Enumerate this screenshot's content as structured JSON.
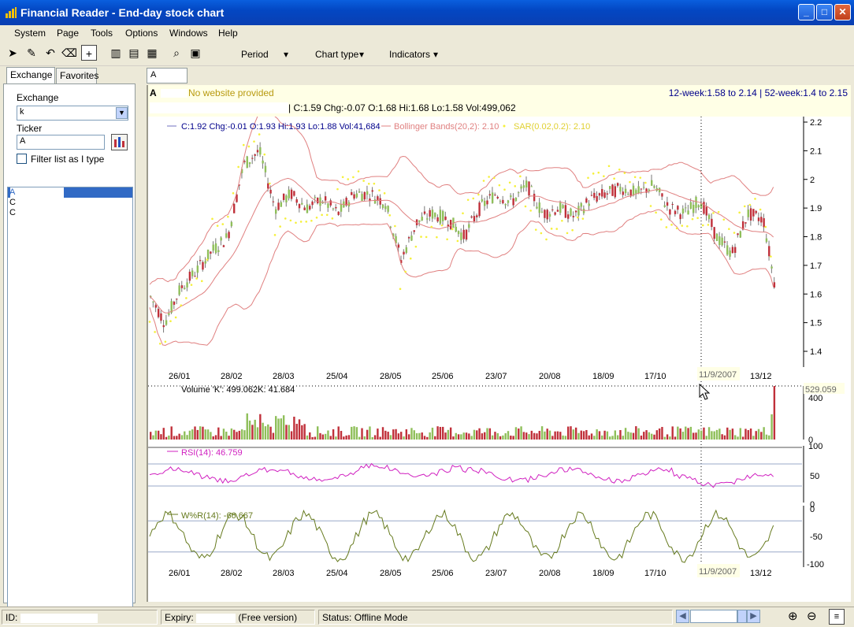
{
  "window": {
    "title": "Financial Reader - End-day stock chart",
    "minimize": "_",
    "maximize": "□",
    "close": "✕"
  },
  "menu": [
    "System",
    "Page",
    "Tools",
    "Options",
    "Windows",
    "Help"
  ],
  "toolbar": {
    "period": "Period",
    "chart_type": "Chart type",
    "indicators": "Indicators",
    "dd_arrow": "▾"
  },
  "left": {
    "tabs": [
      "Exchange",
      "Favorites"
    ],
    "exchange_label": "Exchange",
    "exchange_value": "k",
    "ticker_label": "Ticker",
    "ticker_value": "A",
    "filter_label": "Filter list as I type",
    "list": [
      "A",
      "C",
      "C"
    ]
  },
  "chart": {
    "tab_label": "A",
    "ticker": "A",
    "website": "No website provided",
    "range_text": "12-week:1.58 to 2.14 | 52-week:1.4 to 2.15",
    "quote_text": "| C:1.59 Chg:-0.07 O:1.68 Hi:1.68 Lo:1.58 Vol:499,062",
    "cursor_quote": "C:1.92 Chg:-0.01 O:1.93 Hi:1.93 Lo:1.88 Vol:41,684",
    "bollinger": "Bollinger Bands(20,2): 2.10",
    "sar": "SAR(0.02,0.2): 2.10",
    "price_ticks": [
      "2.2",
      "2.1",
      "2",
      "1.9",
      "1.8",
      "1.7",
      "1.6",
      "1.5",
      "1.4"
    ],
    "date_ticks": [
      "26/01",
      "28/02",
      "28/03",
      "25/04",
      "28/05",
      "25/06",
      "23/07",
      "20/08",
      "18/09",
      "17/10",
      "13/12"
    ],
    "cursor_date": "11/9/2007",
    "volume_label": "Volume 'K': 499.062K: 41.684",
    "volume_value": "529.059",
    "volume_ticks": [
      "400",
      "0"
    ],
    "rsi_label": "RSI(14): 46.759",
    "rsi_ticks": [
      "100",
      "50",
      "0"
    ],
    "wr_label": "W%R(14): -66.667",
    "wr_ticks": [
      "0",
      "-50",
      "-100"
    ],
    "colors": {
      "up": "#8fbf5a",
      "down": "#c0303a",
      "bollinger": "#e08080",
      "sar": "#f5f03a",
      "rsi": "#d020c0",
      "wr": "#667a1e"
    }
  },
  "status": {
    "id_label": "ID:",
    "expiry_label": "Expiry:",
    "version": "(Free version)",
    "status_text": "Status: Offline Mode"
  }
}
